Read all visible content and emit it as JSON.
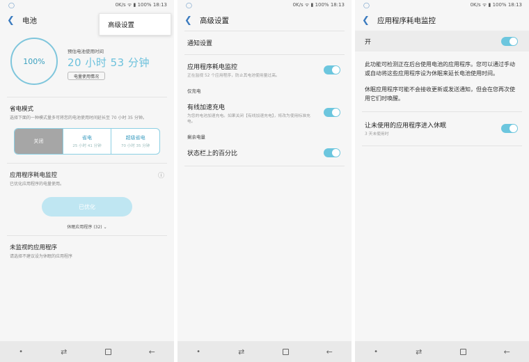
{
  "status": {
    "net": "0K/s",
    "battery": "100%",
    "time": "18:13"
  },
  "screen1": {
    "title": "电池",
    "popup": "高级设置",
    "battery_percent": "100%",
    "estimate_label": "预估电池使用时间",
    "estimate_time": "20 小时 53 分钟",
    "usage_button": "电量使用情况",
    "power_mode_title": "省电模式",
    "power_mode_desc": "选择下面的一种模式量多可将您的电池使用时间延长至 70 小时 35 分钟。",
    "modes": [
      {
        "name": "关闭",
        "sub": ""
      },
      {
        "name": "省电",
        "sub": "25 小时 41 分钟"
      },
      {
        "name": "超级省电",
        "sub": "70 小时 35 分钟"
      }
    ],
    "monitor_title": "应用程序耗电监控",
    "monitor_desc": "已优化应用程序的电量使用。",
    "optimize_button": "已优化",
    "sleeping_apps": "休眠应用程序 (32)",
    "unmonitored_title": "未监视的应用程序",
    "unmonitored_desc": "请选择不建议设为休眠的应用程序"
  },
  "screen2": {
    "title": "高级设置",
    "notification": "通知设置",
    "monitor_title": "应用程序耗电监控",
    "monitor_desc": "正在监视 52 个应用程序，防止其电池使用量过高。",
    "cat_charging": "仅充电",
    "fast_charge_title": "有线加速充电",
    "fast_charge_desc": "为您的电池加速充电。如果关闭【有线加速充电】，将改为使用标准充电。",
    "cat_remaining": "剩余电量",
    "percent_title": "状态栏上的百分比"
  },
  "screen3": {
    "title": "应用程序耗电监控",
    "on_label": "开",
    "para1": "此功能可检测正在后台使用电池的应用程序。您可以通过手动或自动将这些应用程序设为休眠来延长电池使用时间。",
    "para2": "休眠应用程序可能不会接收更新或发送通知，但会在您再次使用它们时唤醒。",
    "sleep_title": "让未使用的应用程序进入休眠",
    "sleep_desc": "3 天未使用时"
  },
  "colors": {
    "accent": "#6cc6de",
    "nav": "#e9e9e9"
  }
}
